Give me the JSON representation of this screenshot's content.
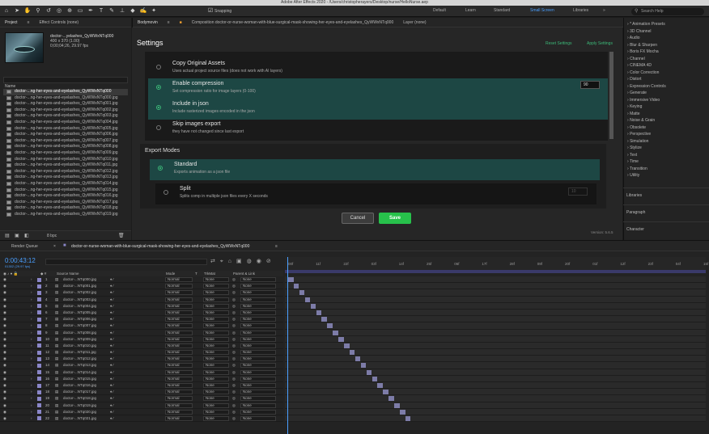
{
  "window_title": "Adobe After Effects 2020 - /Users/christopherayers/Desktop/nurse/HelloNurse.aep",
  "toolbar": {
    "snapping": "Snapping"
  },
  "workspaces": [
    "Default",
    "Learn",
    "Standard",
    "Small Screen",
    "Libraries"
  ],
  "active_workspace": "Small Screen",
  "search_help": "Search Help",
  "project": {
    "tab_project": "Project",
    "tab_effect_controls": "Effect Controls (none)",
    "item_name": "doctor-...yelashes_QyWWxNTq000",
    "size": "400 x 370 (1.00)",
    "duration": "0;00;04;26, 29.97 fps",
    "name_header": "Name",
    "bpc": "8 bpc",
    "files": [
      "doctor-...ng-her-eyes-and-eyelashes_QyWWxNTq000",
      "doctor-...ng-her-eyes-and-eyelashes_QyWWxNTq000.jpg",
      "doctor-...ng-her-eyes-and-eyelashes_QyWWxNTq001.jpg",
      "doctor-...ng-her-eyes-and-eyelashes_QyWWxNTq002.jpg",
      "doctor-...ng-her-eyes-and-eyelashes_QyWWxNTq003.jpg",
      "doctor-...ng-her-eyes-and-eyelashes_QyWWxNTq004.jpg",
      "doctor-...ng-her-eyes-and-eyelashes_QyWWxNTq005.jpg",
      "doctor-...ng-her-eyes-and-eyelashes_QyWWxNTq006.jpg",
      "doctor-...ng-her-eyes-and-eyelashes_QyWWxNTq007.jpg",
      "doctor-...ng-her-eyes-and-eyelashes_QyWWxNTq008.jpg",
      "doctor-...ng-her-eyes-and-eyelashes_QyWWxNTq009.jpg",
      "doctor-...ng-her-eyes-and-eyelashes_QyWWxNTq010.jpg",
      "doctor-...ng-her-eyes-and-eyelashes_QyWWxNTq011.jpg",
      "doctor-...ng-her-eyes-and-eyelashes_QyWWxNTq012.jpg",
      "doctor-...ng-her-eyes-and-eyelashes_QyWWxNTq013.jpg",
      "doctor-...ng-her-eyes-and-eyelashes_QyWWxNTq014.jpg",
      "doctor-...ng-her-eyes-and-eyelashes_QyWWxNTq015.jpg",
      "doctor-...ng-her-eyes-and-eyelashes_QyWWxNTq016.jpg",
      "doctor-...ng-her-eyes-and-eyelashes_QyWWxNTq017.jpg",
      "doctor-...ng-her-eyes-and-eyelashes_QyWWxNTq018.jpg",
      "doctor-...ng-her-eyes-and-eyelashes_QyWWxNTq019.jpg"
    ]
  },
  "bodymovin": {
    "tab": "Bodymovin",
    "comp_tab": "Composition doctor-or-nurse-woman-with-blue-surgical-mask-showing-her-eyes-and-eyelashes_QyWWxNTq000",
    "layer_tab": "Layer (none)",
    "settings": "Settings",
    "reset": "Reset Settings",
    "apply": "Apply Settings",
    "options": [
      {
        "title": "Copy Original Assets",
        "desc": "Uses actual project source files (does not work with AI layers)",
        "on": false
      },
      {
        "title": "Enable compression",
        "desc": "Set compression ratio for image layers (0-100)",
        "on": true
      },
      {
        "title": "Include in json",
        "desc": "Include rasterized images encoded in the json",
        "on": true
      },
      {
        "title": "Skip images export",
        "desc": "they have not changed since last export",
        "on": false
      }
    ],
    "compression_value": "90",
    "export_modes": "Export Modes",
    "modes": [
      {
        "title": "Standard",
        "desc": "Exports animation as a json file",
        "on": true
      },
      {
        "title": "Split",
        "desc": "Splits comp in multiple json files every X seconds",
        "on": false
      }
    ],
    "split_value": "10",
    "cancel": "Cancel",
    "save": "Save",
    "version": "Version: 5.6.5"
  },
  "effects": [
    "* Animation Presets",
    "3D Channel",
    "Audio",
    "Blur & Sharpen",
    "Boris FX Mocha",
    "Channel",
    "CINEMA 4D",
    "Color Correction",
    "Distort",
    "Expression Controls",
    "Generate",
    "Immersive Video",
    "Keying",
    "Matte",
    "Noise & Grain",
    "Obsolete",
    "Perspective",
    "Simulation",
    "Stylize",
    "Text",
    "Time",
    "Transition",
    "Utility"
  ],
  "side_panels": [
    "Libraries",
    "Paragraph",
    "Character"
  ],
  "timeline": {
    "render_queue": "Render Queue",
    "comp_tab": "doctor-or-nurse-woman-with-blue-surgical-mask-showing-her-eyes-and-eyelashes_QyWWxNTq000",
    "timecode": "0:00:43:12",
    "fps": "01302 (29.97 fps)",
    "headers": {
      "source": "Source Name",
      "mode": "Mode",
      "t": "T",
      "trkmat": "TrkMat",
      "parent": "Parent & Link"
    },
    "ticks": [
      "00f",
      "11f",
      "22f",
      "03f",
      "14f",
      "25f",
      "06f",
      "17f",
      "28f",
      "09f",
      "20f",
      "01f",
      "12f",
      "23f",
      "04f",
      "15f"
    ],
    "layers": [
      {
        "num": "1",
        "name": "doctor-...NTq000.jpg",
        "mode": "Normal",
        "trk": "None",
        "parent": "None"
      },
      {
        "num": "2",
        "name": "doctor-...NTq001.jpg",
        "mode": "Normal",
        "trk": "None",
        "parent": "None"
      },
      {
        "num": "3",
        "name": "doctor-...NTq002.jpg",
        "mode": "Normal",
        "trk": "None",
        "parent": "None"
      },
      {
        "num": "4",
        "name": "doctor-...NTq003.jpg",
        "mode": "Normal",
        "trk": "None",
        "parent": "None"
      },
      {
        "num": "5",
        "name": "doctor-...NTq004.jpg",
        "mode": "Normal",
        "trk": "None",
        "parent": "None"
      },
      {
        "num": "6",
        "name": "doctor-...NTq005.jpg",
        "mode": "Normal",
        "trk": "None",
        "parent": "None"
      },
      {
        "num": "7",
        "name": "doctor-...NTq006.jpg",
        "mode": "Normal",
        "trk": "None",
        "parent": "None"
      },
      {
        "num": "8",
        "name": "doctor-...NTq007.jpg",
        "mode": "Normal",
        "trk": "None",
        "parent": "None"
      },
      {
        "num": "9",
        "name": "doctor-...NTq008.jpg",
        "mode": "Normal",
        "trk": "None",
        "parent": "None"
      },
      {
        "num": "10",
        "name": "doctor-...NTq009.jpg",
        "mode": "Normal",
        "trk": "None",
        "parent": "None"
      },
      {
        "num": "11",
        "name": "doctor-...NTq010.jpg",
        "mode": "Normal",
        "trk": "None",
        "parent": "None"
      },
      {
        "num": "12",
        "name": "doctor-...NTq011.jpg",
        "mode": "Normal",
        "trk": "None",
        "parent": "None"
      },
      {
        "num": "13",
        "name": "doctor-...NTq012.jpg",
        "mode": "Normal",
        "trk": "None",
        "parent": "None"
      },
      {
        "num": "14",
        "name": "doctor-...NTq013.jpg",
        "mode": "Normal",
        "trk": "None",
        "parent": "None"
      },
      {
        "num": "15",
        "name": "doctor-...NTq014.jpg",
        "mode": "Normal",
        "trk": "None",
        "parent": "None"
      },
      {
        "num": "16",
        "name": "doctor-...NTq015.jpg",
        "mode": "Normal",
        "trk": "None",
        "parent": "None"
      },
      {
        "num": "17",
        "name": "doctor-...NTq016.jpg",
        "mode": "Normal",
        "trk": "None",
        "parent": "None"
      },
      {
        "num": "18",
        "name": "doctor-...NTq017.jpg",
        "mode": "Normal",
        "trk": "None",
        "parent": "None"
      },
      {
        "num": "19",
        "name": "doctor-...NTq018.jpg",
        "mode": "Normal",
        "trk": "None",
        "parent": "None"
      },
      {
        "num": "20",
        "name": "doctor-...NTq019.jpg",
        "mode": "Normal",
        "trk": "None",
        "parent": "None"
      },
      {
        "num": "21",
        "name": "doctor-...NTq020.jpg",
        "mode": "Normal",
        "trk": "None",
        "parent": "None"
      },
      {
        "num": "22",
        "name": "doctor-...NTq021.jpg",
        "mode": "Normal",
        "trk": "None",
        "parent": "None"
      }
    ]
  },
  "colors": {
    "accent": "#4a9fff",
    "save": "#27c14b",
    "selected_row": "#1d4744",
    "layer_bar": "#7d7ca8"
  }
}
